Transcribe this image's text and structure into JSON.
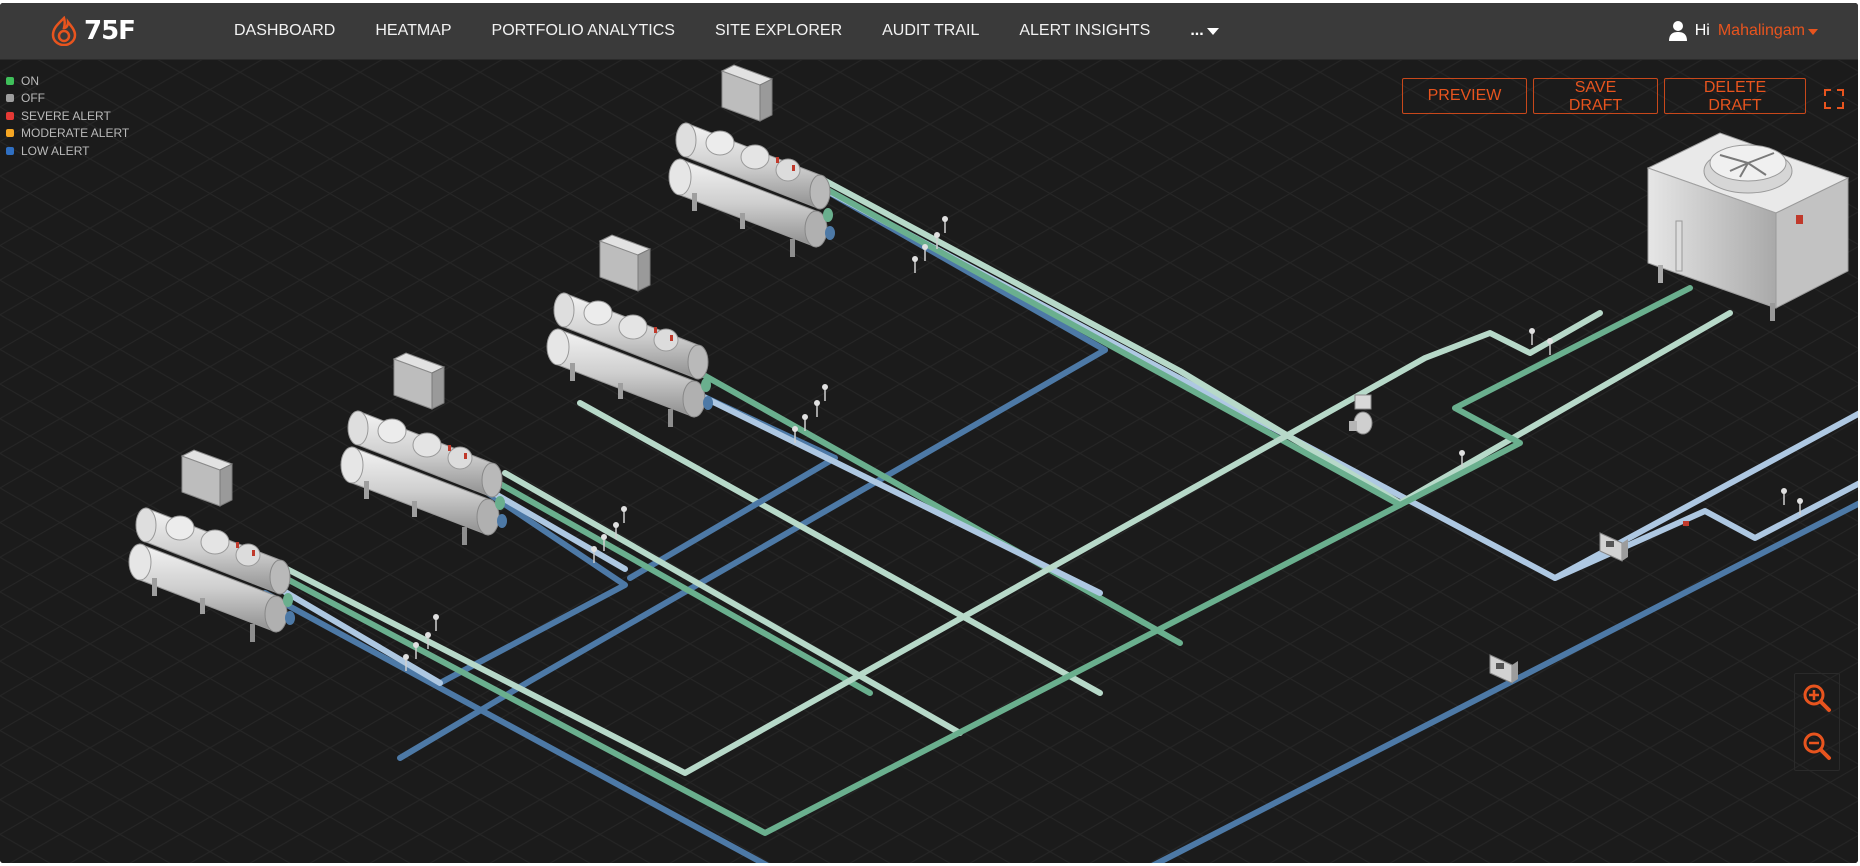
{
  "header": {
    "logo_text": "75F",
    "nav": [
      "DASHBOARD",
      "HEATMAP",
      "PORTFOLIO ANALYTICS",
      "SITE EXPLORER",
      "AUDIT TRAIL",
      "ALERT INSIGHTS"
    ],
    "more_label": "...",
    "greeting": "Hi",
    "username": "Mahalingam"
  },
  "legend": [
    {
      "label": "ON",
      "color": "#3fbf5a"
    },
    {
      "label": "OFF",
      "color": "#9e9e9e"
    },
    {
      "label": "SEVERE ALERT",
      "color": "#e53935"
    },
    {
      "label": "MODERATE ALERT",
      "color": "#f5a623"
    },
    {
      "label": "LOW ALERT",
      "color": "#2f6fc2"
    }
  ],
  "actions": {
    "preview": "PREVIEW",
    "save_draft": "SAVE DRAFT",
    "delete_draft": "DELETE DRAFT"
  },
  "icons": [
    "user-icon",
    "fullscreen-icon",
    "zoom-in-icon",
    "zoom-out-icon"
  ],
  "colors": {
    "accent": "#e8541e",
    "pipe_light_green": "#b7d9c9",
    "pipe_green": "#6aaf8e",
    "pipe_light_blue": "#aec8e2",
    "pipe_blue": "#4d79a6",
    "background": "#1b1b1b"
  }
}
